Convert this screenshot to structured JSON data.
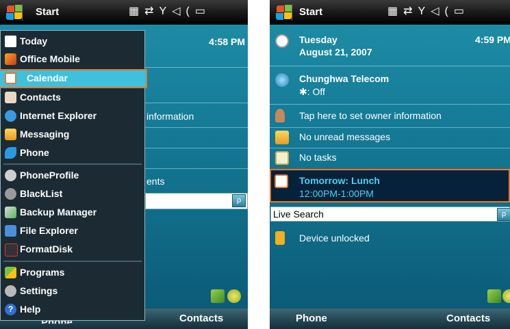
{
  "left": {
    "topbar": {
      "title": "Start",
      "status_icons": [
        "signal-off-icon",
        "connection-icon",
        "antenna-icon",
        "volume-icon",
        "battery-icon"
      ]
    },
    "time": "4:58 PM",
    "background_fragments": {
      "owner_info": "information",
      "appointments": "ents"
    },
    "menu": {
      "groups": [
        [
          {
            "label": "Today",
            "icon": "today-icon"
          },
          {
            "label": "Office Mobile",
            "icon": "office-mobile-icon"
          },
          {
            "label": "Calendar",
            "icon": "calendar-icon",
            "selected": true
          },
          {
            "label": "Contacts",
            "icon": "contacts-icon"
          },
          {
            "label": "Internet Explorer",
            "icon": "internet-explorer-icon"
          },
          {
            "label": "Messaging",
            "icon": "messaging-icon"
          },
          {
            "label": "Phone",
            "icon": "phone-icon"
          }
        ],
        [
          {
            "label": "PhoneProfile",
            "icon": "phoneprofile-icon"
          },
          {
            "label": "BlackList",
            "icon": "blacklist-icon"
          },
          {
            "label": "Backup Manager",
            "icon": "backup-manager-icon"
          },
          {
            "label": "File Explorer",
            "icon": "file-explorer-icon"
          },
          {
            "label": "FormatDisk",
            "icon": "formatdisk-icon"
          }
        ],
        [
          {
            "label": "Programs",
            "icon": "programs-icon"
          },
          {
            "label": "Settings",
            "icon": "settings-icon"
          },
          {
            "label": "Help",
            "icon": "help-icon"
          }
        ]
      ]
    },
    "softkeys": {
      "left": "Phone",
      "right": "Contacts"
    }
  },
  "right": {
    "topbar": {
      "title": "Start",
      "status_icons": [
        "signal-off-icon",
        "connection-icon",
        "antenna-icon",
        "volume-icon",
        "battery-icon"
      ]
    },
    "date_day": "Tuesday",
    "date_full": "August 21, 2007",
    "time": "4:59 PM",
    "carrier": "Chunghwa Telecom",
    "bluetooth": ": Off",
    "owner_info": "Tap here to set owner information",
    "messages": "No unread messages",
    "tasks": "No tasks",
    "appointment_title": "Tomorrow: Lunch",
    "appointment_time": "12:00PM-1:00PM",
    "search_label": "Live Search",
    "device_lock": "Device unlocked",
    "softkeys": {
      "left": "Phone",
      "right": "Contacts"
    }
  },
  "colors": {
    "accent": "#e7772a",
    "selection": "#3fc0dd",
    "appointment_text": "#49d3f0",
    "screen_bg": "#1f8fa8"
  }
}
